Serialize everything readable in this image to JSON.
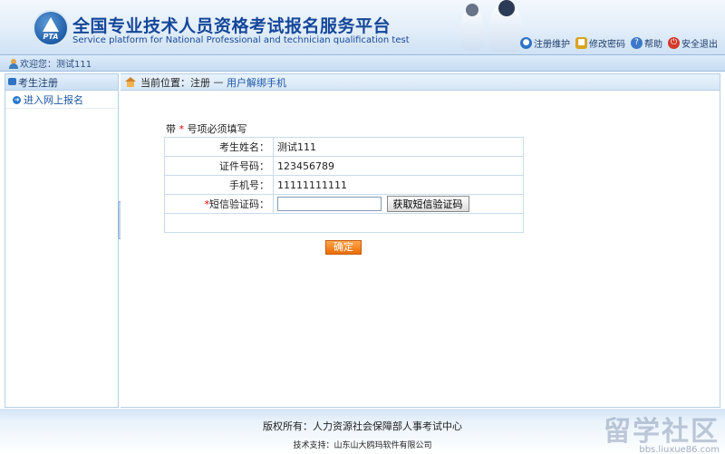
{
  "header": {
    "logo_text": "PTA",
    "title_cn": "全国专业技术人员资格考试报名服务平台",
    "title_en": "Service platform for National Professional and technician qualification test",
    "links": [
      "注册维护",
      "修改密码",
      "帮助",
      "安全退出"
    ]
  },
  "welcome": "欢迎您：测试111",
  "sidebar": {
    "section": "考生注册",
    "items": [
      {
        "label": "进入网上报名"
      }
    ]
  },
  "breadcrumb": {
    "prefix": "当前位置：注册",
    "separator": "—",
    "current": "用户解绑手机"
  },
  "form": {
    "notice_before": "带",
    "notice_mark": "*",
    "notice_after": "号项必须填写",
    "rows": [
      {
        "label": "考生姓名：",
        "value": "测试111"
      },
      {
        "label": "证件号码：",
        "value": "123456789"
      },
      {
        "label": "手机号：",
        "value": "11111111111"
      }
    ],
    "sms_required_mark": "*",
    "sms_label": "短信验证码：",
    "sms_value": "",
    "sms_button": "获取短信验证码",
    "confirm": "确定"
  },
  "footer": {
    "copyright": "版权所有：人力资源社会保障部人事考试中心",
    "support": "技术支持：山东山大鸥玛软件有限公司",
    "watermark": "留学社区",
    "watermark_url": "bbs.liuxue86.com"
  }
}
